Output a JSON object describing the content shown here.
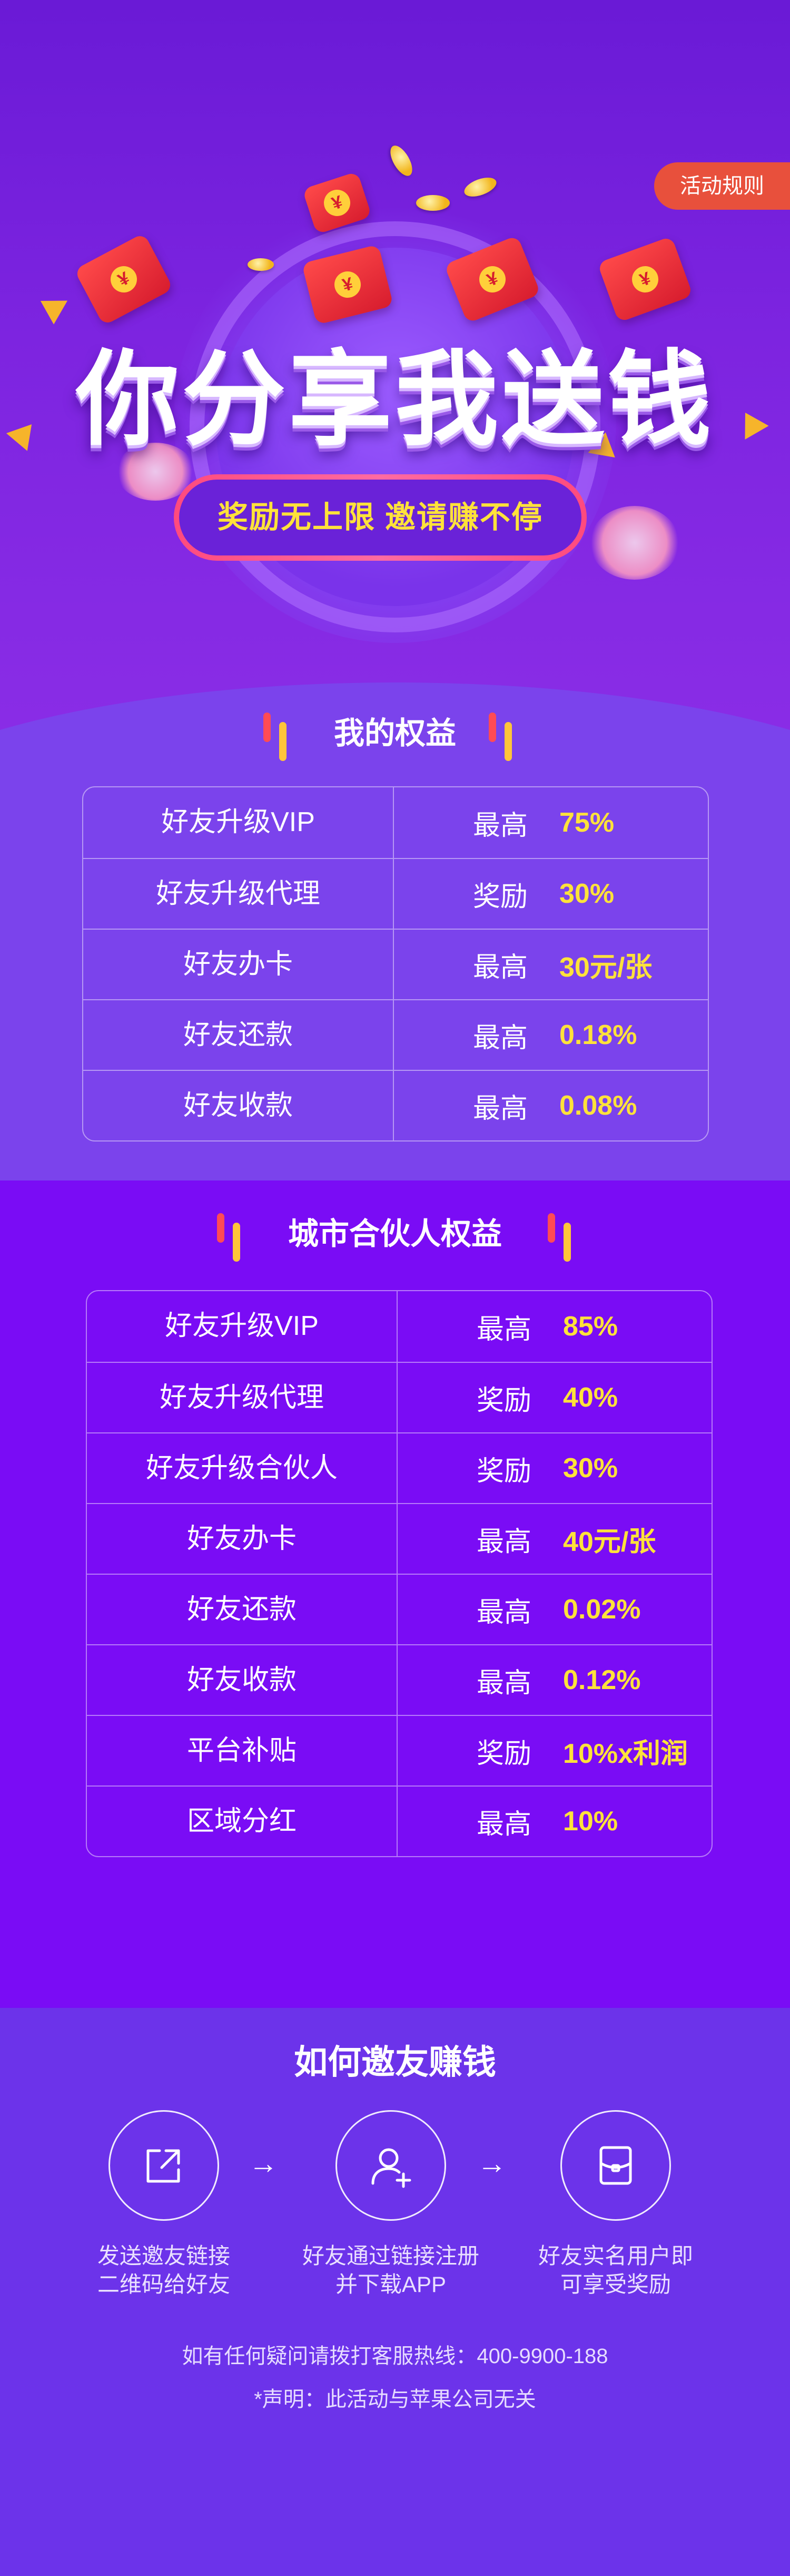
{
  "hero": {
    "rule_button": "活动规则",
    "title": "你分享我送钱",
    "slogan": "奖励无上限  邀请赚不停"
  },
  "my_rights": {
    "heading": "我的权益",
    "rows": [
      {
        "item": "好友升级VIP",
        "label": "最高",
        "value": "75%"
      },
      {
        "item": "好友升级代理",
        "label": "奖励",
        "value": "30%"
      },
      {
        "item": "好友办卡",
        "label": "最高",
        "value": "30元/张"
      },
      {
        "item": "好友还款",
        "label": "最高",
        "value": "0.18%"
      },
      {
        "item": "好友收款",
        "label": "最高",
        "value": "0.08%"
      }
    ]
  },
  "partner_rights": {
    "heading": "城市合伙人权益",
    "rows": [
      {
        "item": "好友升级VIP",
        "label": "最高",
        "value": "85%"
      },
      {
        "item": "好友升级代理",
        "label": "奖励",
        "value": "40%"
      },
      {
        "item": "好友升级合伙人",
        "label": "奖励",
        "value": "30%"
      },
      {
        "item": "好友办卡",
        "label": "最高",
        "value": "40元/张"
      },
      {
        "item": "好友还款",
        "label": "最高",
        "value": "0.02%"
      },
      {
        "item": "好友收款",
        "label": "最高",
        "value": "0.12%"
      },
      {
        "item": "平台补贴",
        "label": "奖励",
        "value": "10%x利润"
      },
      {
        "item": "区域分红",
        "label": "最高",
        "value": "10%"
      }
    ]
  },
  "how": {
    "heading": "如何邀友赚钱",
    "steps": [
      {
        "icon": "share-icon",
        "line1": "发送邀友链接",
        "line2": "二维码给好友"
      },
      {
        "icon": "add-user-icon",
        "line1": "好友通过链接注册",
        "line2": "并下载APP"
      },
      {
        "icon": "red-envelope-icon",
        "line1": "好友实名用户即",
        "line2": "可享受奖励"
      }
    ],
    "arrow": "→",
    "hotline": "如有任何疑问请拨打客服热线：400-9900-188",
    "notice": "*声明：此活动与苹果公司无关"
  },
  "colors": {
    "accent_yellow": "#ffe23a",
    "rule_button": "#e8503c",
    "section_purple": "#7b43ec",
    "section_violet": "#7a0cf5"
  }
}
